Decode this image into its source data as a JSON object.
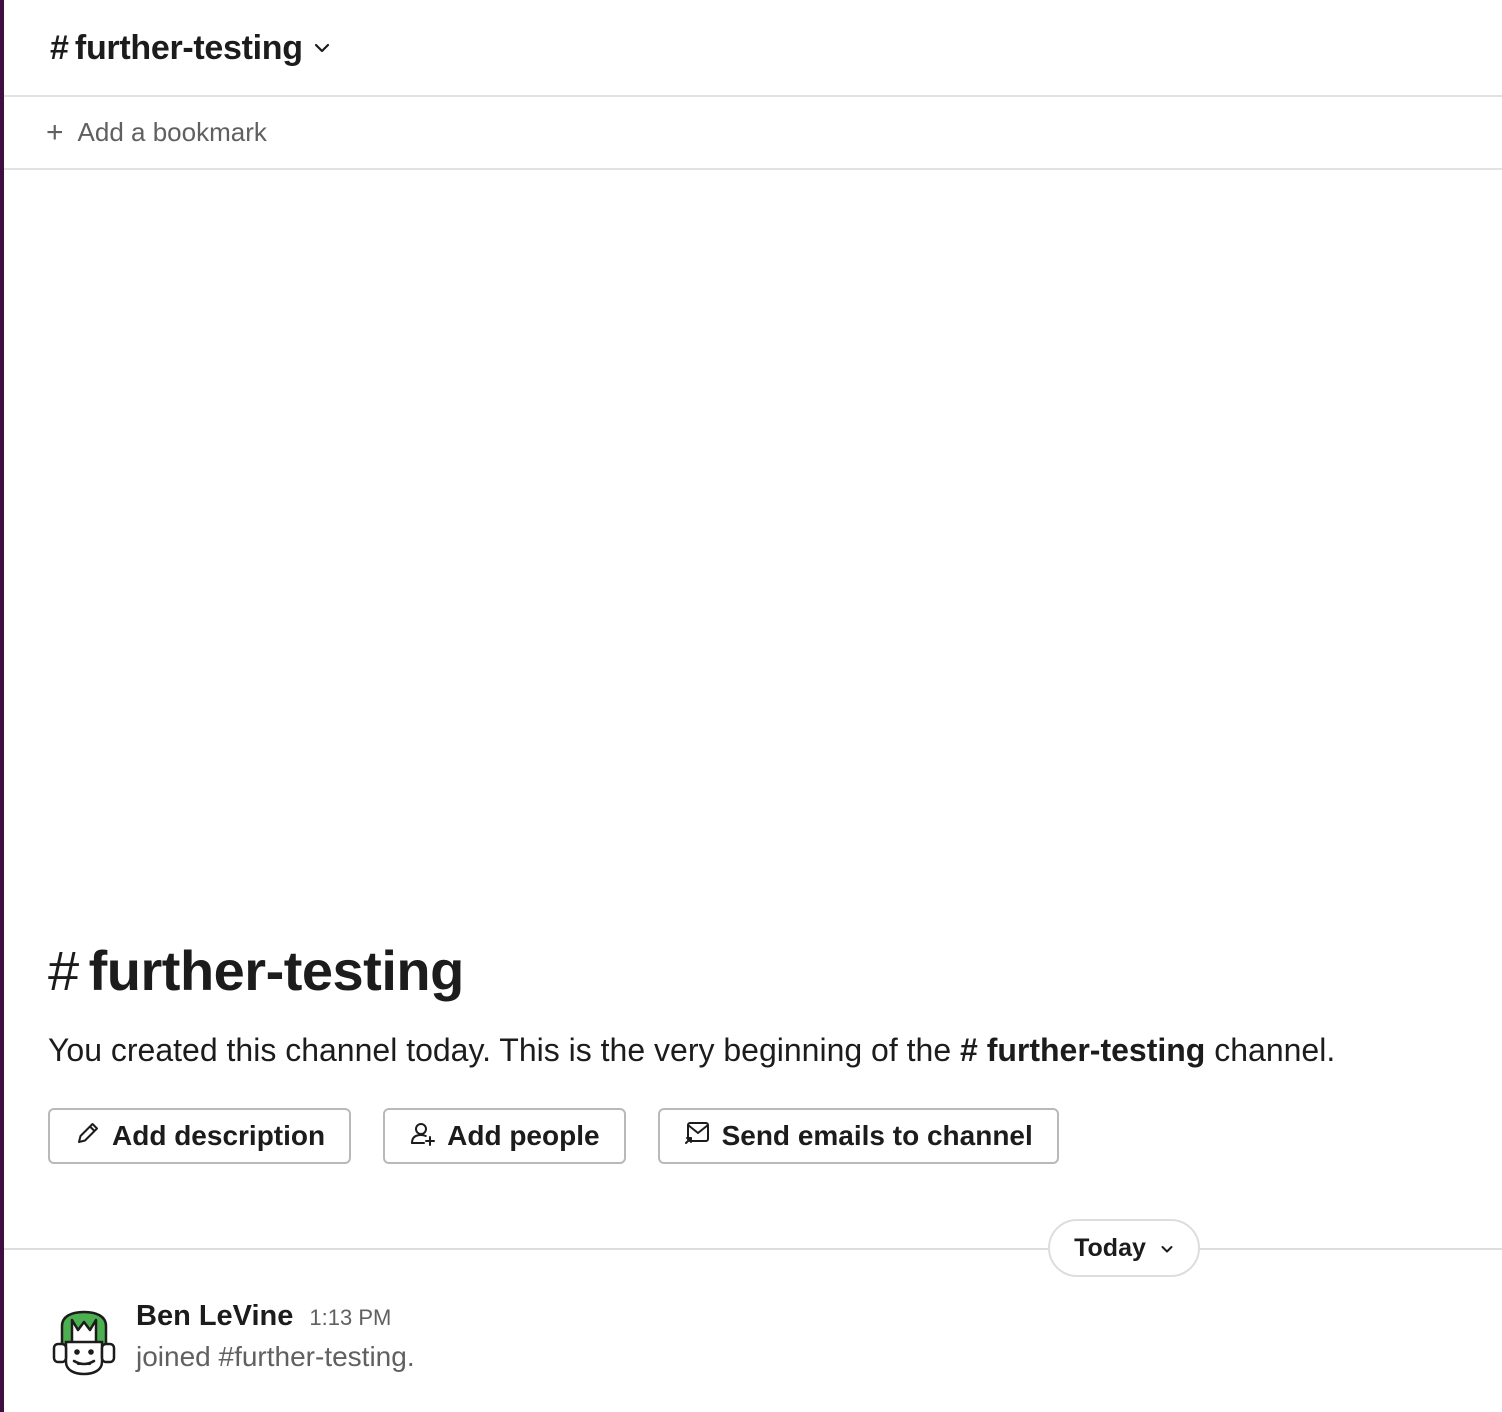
{
  "header": {
    "channel_hash": "#",
    "channel_name": "further-testing",
    "chevron_icon": "chevron-down-icon"
  },
  "bookmarks": {
    "plus": "+",
    "add_label": "Add a bookmark"
  },
  "intro": {
    "hash": "#",
    "title": "further-testing",
    "text_before": "You created this channel today. This is the very beginning of the ",
    "channel_ref": "# further-testing",
    "text_after": " channel.",
    "buttons": {
      "add_description": "Add description",
      "add_people": "Add people",
      "send_emails": "Send emails to channel"
    }
  },
  "divider": {
    "label": "Today"
  },
  "message": {
    "author": "Ben LeVine",
    "time": "1:13 PM",
    "text": "joined #further-testing.",
    "avatar_colors": {
      "background": "#4caf50",
      "face": "#ffffff",
      "outline": "#1d1c1d"
    }
  },
  "colors": {
    "sidebar_edge": "#3f0e40",
    "border": "#e2e2e2",
    "muted_text": "#616061",
    "text": "#1d1c1d"
  }
}
